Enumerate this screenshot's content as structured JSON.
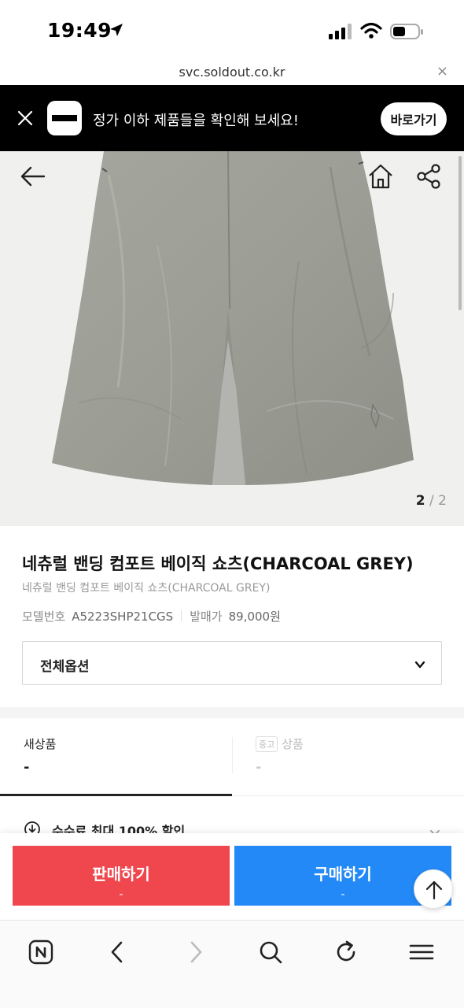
{
  "status_bar": {
    "time": "19:49"
  },
  "url_bar": {
    "url": "svc.soldout.co.kr",
    "close_glyph": "×"
  },
  "banner": {
    "message": "정가 이하 제품들을 확인해 보세요!",
    "button_label": "바로가기"
  },
  "hero": {
    "counter_current": "2",
    "counter_separator": " / ",
    "counter_total": "2"
  },
  "product": {
    "title": "네츄럴 밴딩 컴포트 베이직 쇼츠(CHARCOAL GREY)",
    "subtitle": "네츄럴 밴딩 컴포트 베이직 쇼츠(CHARCOAL GREY)",
    "model_label": "모델번호",
    "model_value": "A5223SHP21CGS",
    "release_price_label": "발매가",
    "release_price_value": "89,000원"
  },
  "option_select": {
    "label": "전체옵션"
  },
  "price_tabs": {
    "new": {
      "name": "새상품",
      "value": "-"
    },
    "used": {
      "badge": "중고",
      "name": "상품",
      "value": "-"
    }
  },
  "fee_promo": {
    "text": "수수료 최대 100% 할인"
  },
  "actions": {
    "sell": {
      "label": "판매하기",
      "price": "-"
    },
    "buy": {
      "label": "구매하기",
      "price": "-"
    }
  },
  "colors": {
    "sell": "#f0474f",
    "buy": "#2289f7",
    "banner_bg": "#000000",
    "hero_bg": "#f0f0ef"
  },
  "icons": {
    "back": "arrow-left-icon",
    "home": "home-icon",
    "share": "share-icon",
    "scroll_top": "arrow-up-icon",
    "toolbar": [
      "naver-home-icon",
      "chevron-left-icon",
      "chevron-right-icon",
      "search-icon",
      "refresh-icon",
      "menu-icon"
    ]
  }
}
